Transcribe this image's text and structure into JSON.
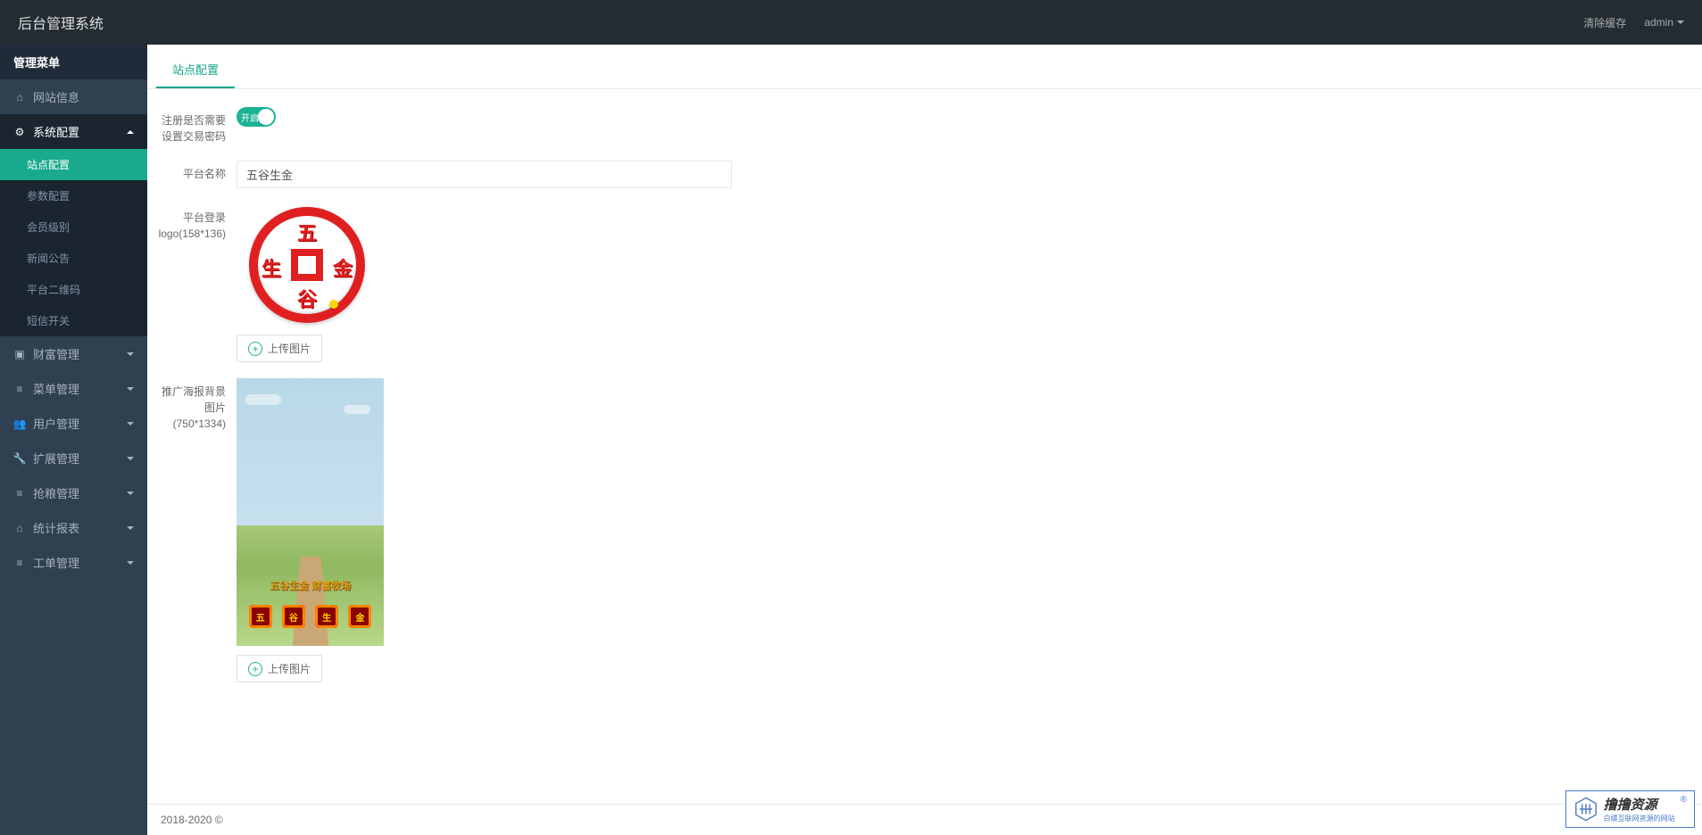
{
  "header": {
    "title": "后台管理系统",
    "clear_cache": "清除缓存",
    "user": "admin"
  },
  "sidebar": {
    "menu_header": "管理菜单",
    "items": [
      {
        "icon": "home",
        "label": "网站信息",
        "expandable": false
      },
      {
        "icon": "cogs",
        "label": "系统配置",
        "expandable": true,
        "expanded": true,
        "children": [
          {
            "label": "站点配置",
            "active": true
          },
          {
            "label": "参数配置"
          },
          {
            "label": "会员级别"
          },
          {
            "label": "新闻公告"
          },
          {
            "label": "平台二维码"
          },
          {
            "label": "短信开关"
          }
        ]
      },
      {
        "icon": "money",
        "label": "财富管理",
        "expandable": true
      },
      {
        "icon": "list",
        "label": "菜单管理",
        "expandable": true
      },
      {
        "icon": "users",
        "label": "用户管理",
        "expandable": true
      },
      {
        "icon": "wrench",
        "label": "扩展管理",
        "expandable": true
      },
      {
        "icon": "list",
        "label": "抢粮管理",
        "expandable": true
      },
      {
        "icon": "home",
        "label": "统计报表",
        "expandable": true
      },
      {
        "icon": "list",
        "label": "工单管理",
        "expandable": true
      }
    ]
  },
  "main": {
    "tab": "站点配置",
    "form": {
      "register_pwd_label": "注册是否需要设置交易密码",
      "toggle_on": "开启",
      "platform_name_label": "平台名称",
      "platform_name_value": "五谷生金",
      "login_logo_label": "平台登录logo(158*136)",
      "poster_bg_label": "推广海报背景图片(750*1334)",
      "upload_btn": "上传图片",
      "logo_chars": {
        "top": "五",
        "bottom": "谷",
        "left": "生",
        "right": "金"
      },
      "poster_banner": "五谷生金 财富牧场",
      "poster_icons": [
        "五",
        "谷",
        "生",
        "金"
      ]
    }
  },
  "footer": "2018-2020 ©",
  "watermark": {
    "title": "撸撸资源",
    "sub": "白嫖互联网资源的网站",
    "r": "®"
  }
}
